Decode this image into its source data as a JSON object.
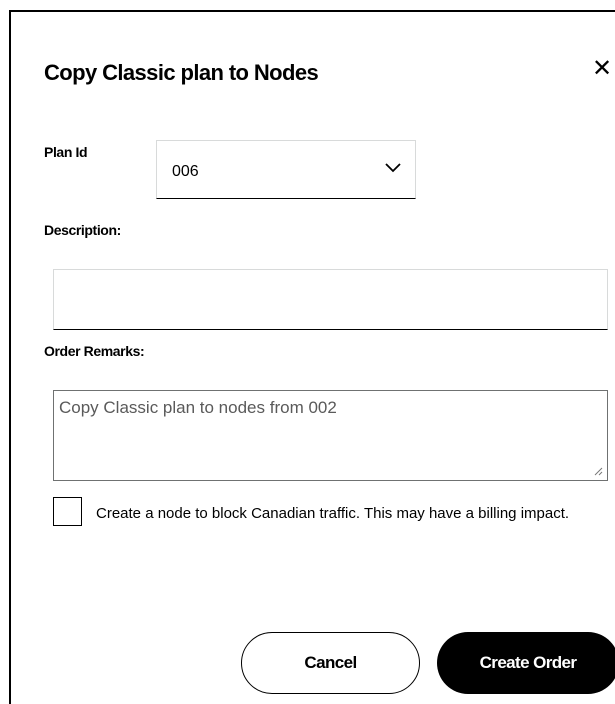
{
  "dialog": {
    "title": "Copy Classic plan to Nodes",
    "close_icon": "close-icon",
    "close_glyph": "✕"
  },
  "form": {
    "plan_id_label": "Plan Id",
    "plan_id_value": "006",
    "plan_id_options": [
      "006"
    ],
    "description_label": "Description:",
    "description_value": "",
    "order_remarks_label": "Order Remarks:",
    "order_remarks_value": "Copy Classic plan to nodes from 002",
    "block_canadian_checked": false,
    "block_canadian_label": "Create a node to block Canadian traffic. This may have a billing impact."
  },
  "actions": {
    "cancel_label": "Cancel",
    "create_label": "Create Order"
  },
  "colors": {
    "primary": "#000000",
    "input_border": "#d8dada",
    "remarks_text": "#5a5a5a"
  }
}
